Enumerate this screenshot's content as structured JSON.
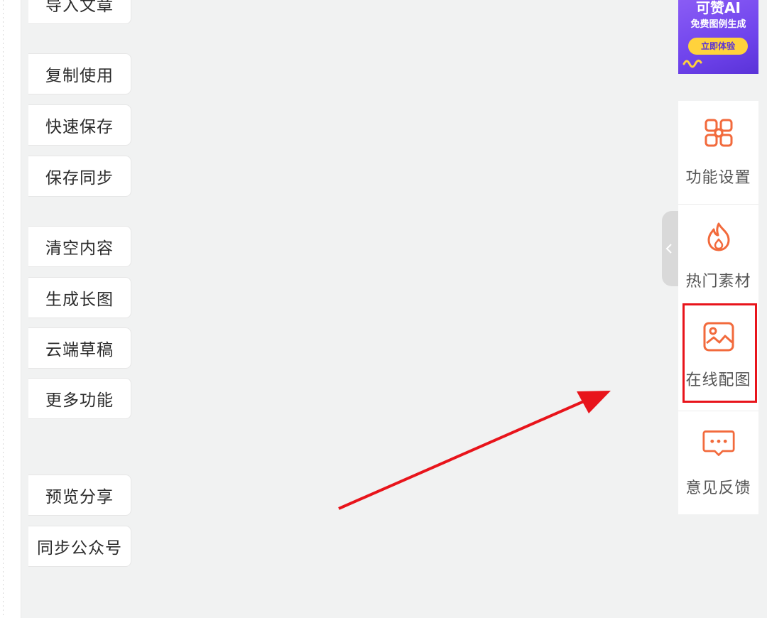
{
  "left_toolbar": {
    "buttons": [
      {
        "label": "导入文章"
      },
      {
        "label": "复制使用"
      },
      {
        "label": "快速保存"
      },
      {
        "label": "保存同步"
      },
      {
        "label": "清空内容"
      },
      {
        "label": "生成长图"
      },
      {
        "label": "云端草稿"
      },
      {
        "label": "更多功能"
      },
      {
        "label": "预览分享"
      },
      {
        "label": "同步公众号"
      }
    ]
  },
  "ad_banner": {
    "title": "可赞AI",
    "subtitle": "免费图例生成",
    "cta": "立即体验"
  },
  "right_sidebar": {
    "items": [
      {
        "label": "功能设置",
        "icon": "grid-settings-icon"
      },
      {
        "label": "热门素材",
        "icon": "flame-icon"
      },
      {
        "label": "在线配图",
        "icon": "image-icon"
      },
      {
        "label": "意见反馈",
        "icon": "chat-bubble-icon"
      }
    ],
    "highlighted_item": "在线配图"
  },
  "colors": {
    "accent": "#f26a3c",
    "highlight_box": "#e8141b",
    "arrow": "#e8141b",
    "ad_background": "#6f43ec",
    "ad_cta": "#ffd23c"
  }
}
